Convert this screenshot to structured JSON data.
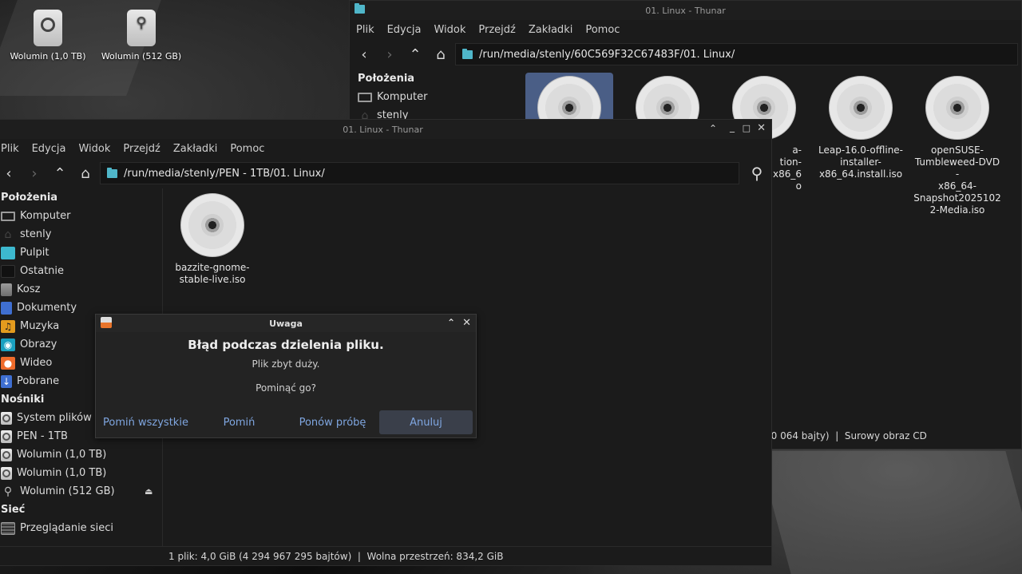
{
  "desktop": {
    "icons": [
      {
        "label": "Wolumin (1,0 TB)"
      },
      {
        "label": "Wolumin (512 GB)"
      }
    ]
  },
  "back_window": {
    "title": "01. Linux - Thunar",
    "menu": [
      "Plik",
      "Edycja",
      "Widok",
      "Przejdź",
      "Zakładki",
      "Pomoc"
    ],
    "path": "/run/media/stenly/60C569F32C67483F/01. Linux/",
    "sidebar_heading": "Położenia",
    "sidebar_items": [
      "Komputer",
      "stenly"
    ],
    "files": [
      {
        "name": ""
      },
      {
        "name": ""
      },
      {
        "name": "a-\ntion-\n..x86_6\no"
      },
      {
        "name": "Leap-16.0-offline-\ninstaller-\nx86_64.install.iso"
      },
      {
        "name": "openSUSE-\nTumbleweed-DVD-\nx86_64-\nSnapshot2025102\n2-Media.iso"
      }
    ],
    "status": "40 064 bajty)  |  Surowy obraz CD"
  },
  "front_window": {
    "title": "01. Linux - Thunar",
    "menu": [
      "Plik",
      "Edycja",
      "Widok",
      "Przejdź",
      "Zakładki",
      "Pomoc"
    ],
    "path": "/run/media/stenly/PEN - 1TB/01. Linux/",
    "sidebar": {
      "places_heading": "Położenia",
      "places": [
        "Komputer",
        "stenly",
        "Pulpit",
        "Ostatnie",
        "Kosz",
        "Dokumenty",
        "Muzyka",
        "Obrazy",
        "Wideo",
        "Pobrane"
      ],
      "devices_heading": "Nośniki",
      "devices": [
        "System plików",
        "PEN - 1TB",
        "Wolumin (1,0 TB)",
        "Wolumin (1,0 TB)",
        "Wolumin (512 GB)"
      ],
      "network_heading": "Sieć",
      "network": [
        "Przeglądanie sieci"
      ]
    },
    "file": {
      "name": "bazzite-gnome-\nstable-live.iso"
    },
    "status": "1 plik: 4,0 GiB (4 294 967 295 bajtów)  |  Wolna przestrzeń: 834,2 GiB"
  },
  "dialog": {
    "title": "Uwaga",
    "heading": "Błąd podczas dzielenia pliku.",
    "message": "Plik zbyt duży.",
    "question": "Pominąć go?",
    "buttons": [
      "Pomiń wszystkie",
      "Pomiń",
      "Ponów próbę",
      "Anuluj"
    ]
  }
}
